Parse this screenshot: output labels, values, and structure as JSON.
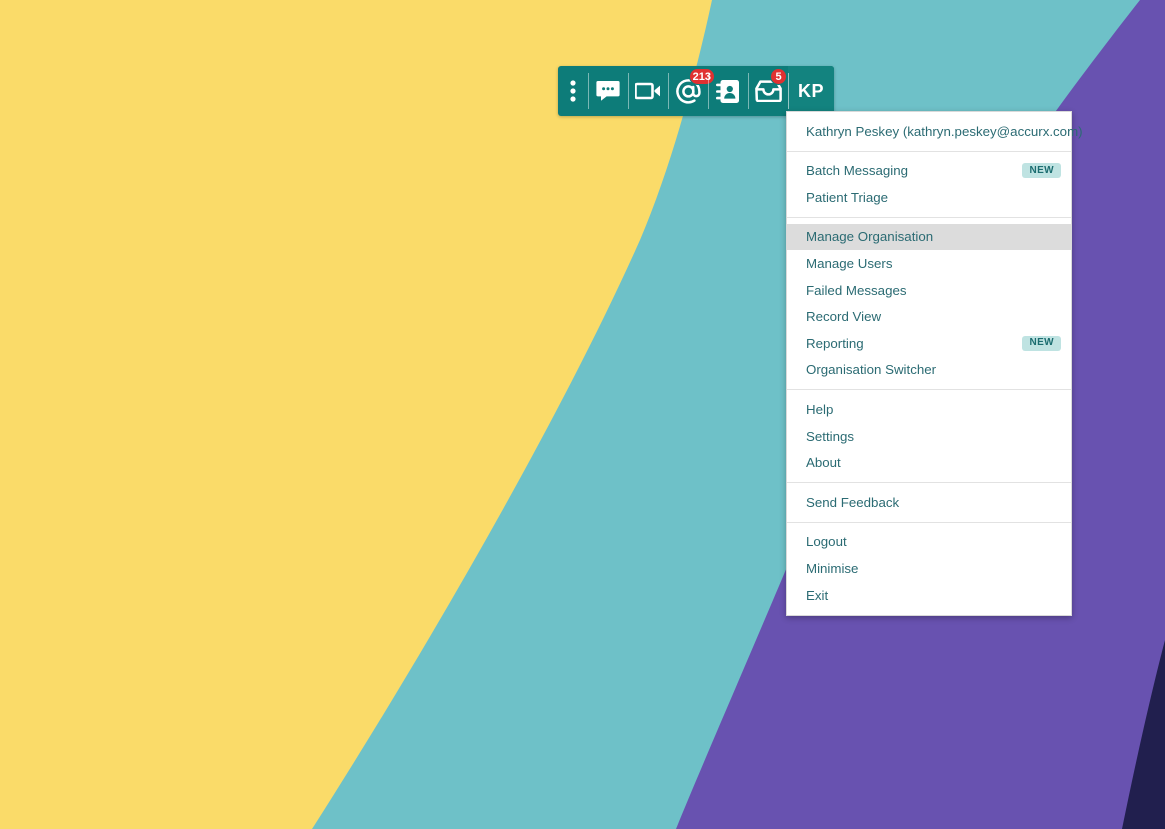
{
  "background": {
    "colors": {
      "yellow": "#fadb69",
      "teal": "#6ec1c8",
      "purple": "#6852b0",
      "navy": "#211f4e"
    }
  },
  "toolbar": {
    "background_color": "#0d7c79",
    "items": [
      {
        "name": "drag-handle",
        "icon": "three-dots-vertical-icon",
        "badge": null
      },
      {
        "name": "messages",
        "icon": "chat-bubble-icon",
        "badge": null
      },
      {
        "name": "video-call",
        "icon": "video-camera-icon",
        "badge": null
      },
      {
        "name": "email",
        "icon": "at-sign-icon",
        "badge": "213"
      },
      {
        "name": "contacts",
        "icon": "address-book-icon",
        "badge": null
      },
      {
        "name": "inbox",
        "icon": "inbox-tray-icon",
        "badge": "5"
      }
    ],
    "avatar": {
      "initials": "KP",
      "background_color": "#13837f"
    },
    "badge_color": "#e03131"
  },
  "menu": {
    "account": {
      "label": "Kathryn Peskey (kathryn.peskey@accurx.com)",
      "user_name": "Kathryn Peskey",
      "email": "kathryn.peskey@accurx.com"
    },
    "new_badge_label": "NEW",
    "highlight_color": "#dcdcdc",
    "groups": [
      {
        "name": "features",
        "items": [
          {
            "label": "Batch Messaging",
            "badge": "NEW",
            "active": false
          },
          {
            "label": "Patient Triage",
            "badge": null,
            "active": false
          }
        ]
      },
      {
        "name": "administration",
        "items": [
          {
            "label": "Manage Organisation",
            "badge": null,
            "active": true
          },
          {
            "label": "Manage Users",
            "badge": null,
            "active": false
          },
          {
            "label": "Failed Messages",
            "badge": null,
            "active": false
          },
          {
            "label": "Record View",
            "badge": null,
            "active": false
          },
          {
            "label": "Reporting",
            "badge": "NEW",
            "active": false
          },
          {
            "label": "Organisation Switcher",
            "badge": null,
            "active": false
          }
        ]
      },
      {
        "name": "support",
        "items": [
          {
            "label": "Help",
            "badge": null,
            "active": false
          },
          {
            "label": "Settings",
            "badge": null,
            "active": false
          },
          {
            "label": "About",
            "badge": null,
            "active": false
          }
        ]
      },
      {
        "name": "feedback",
        "items": [
          {
            "label": "Send Feedback",
            "badge": null,
            "active": false
          }
        ]
      },
      {
        "name": "session",
        "items": [
          {
            "label": "Logout",
            "badge": null,
            "active": false
          },
          {
            "label": "Minimise",
            "badge": null,
            "active": false
          },
          {
            "label": "Exit",
            "badge": null,
            "active": false
          }
        ]
      }
    ]
  }
}
